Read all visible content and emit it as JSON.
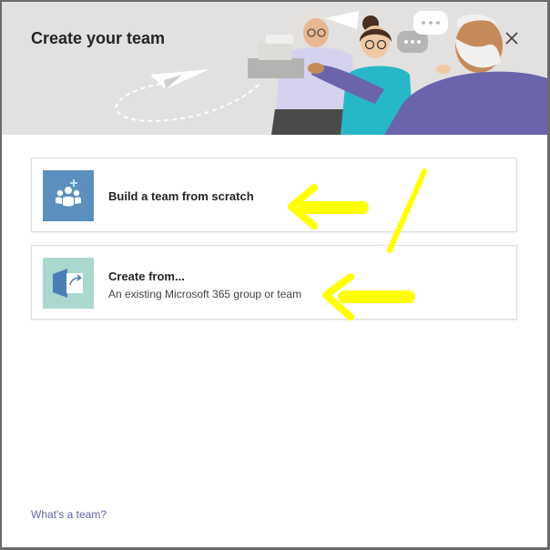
{
  "dialog": {
    "title": "Create your team",
    "close_icon": "close-icon"
  },
  "options": [
    {
      "title": "Build a team from scratch",
      "subtitle": "",
      "icon": "team-add-icon",
      "tile_color": "#5b8fbe"
    },
    {
      "title": "Create from...",
      "subtitle": "An existing Microsoft 365 group or team",
      "icon": "create-from-existing-icon",
      "tile_color": "#aad8cf"
    }
  ],
  "footer": {
    "help_link": "What's a team?"
  },
  "colors": {
    "header_bg": "#e2e1e0",
    "link": "#6264a7",
    "annotation": "#ffff00"
  }
}
